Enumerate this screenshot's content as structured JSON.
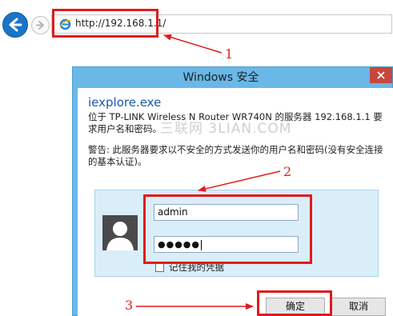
{
  "browser": {
    "url": "http://192.168.1.1/"
  },
  "dialog": {
    "title": "Windows 安全",
    "app_name": "iexplore.exe",
    "description": "位于 TP-LINK Wireless N Router WR740N 的服务器 192.168.1.1 要求用户名和密码。",
    "watermark": "三联网 3LIAN.COM",
    "warning": "警告: 此服务器要求以不安全的方式发送你的用户名和密码(没有安全连接的基本认证)。",
    "username_value": "admin",
    "password_value": "●●●●●",
    "remember_label": "记住我的凭据",
    "ok_label": "确定",
    "cancel_label": "取消"
  },
  "annotations": {
    "step1": "1",
    "step2": "2",
    "step3": "3",
    "color": "#e01b1b"
  }
}
